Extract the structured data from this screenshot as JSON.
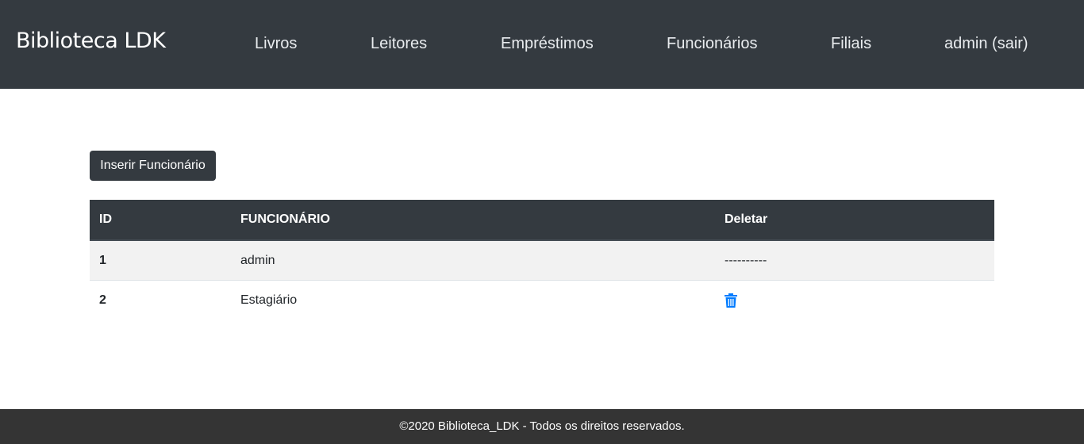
{
  "navbar": {
    "brand": "Biblioteca LDK",
    "links": [
      "Livros",
      "Leitores",
      "Empréstimos",
      "Funcionários",
      "Filiais",
      "admin (sair)"
    ]
  },
  "main": {
    "insert_button": "Inserir Funcionário",
    "table": {
      "headers": [
        "ID",
        "FUNCIONÁRIO",
        "Deletar"
      ],
      "rows": [
        {
          "id": "1",
          "name": "admin",
          "delete": "----------"
        },
        {
          "id": "2",
          "name": "Estagiário",
          "delete_icon": "trash-icon"
        }
      ]
    }
  },
  "colors": {
    "navbar_bg": "#343a40",
    "footer_bg": "#343434",
    "trash_icon": "#007bff"
  },
  "footer": {
    "text": "©2020 Biblioteca_LDK - Todos os direitos reservados."
  }
}
